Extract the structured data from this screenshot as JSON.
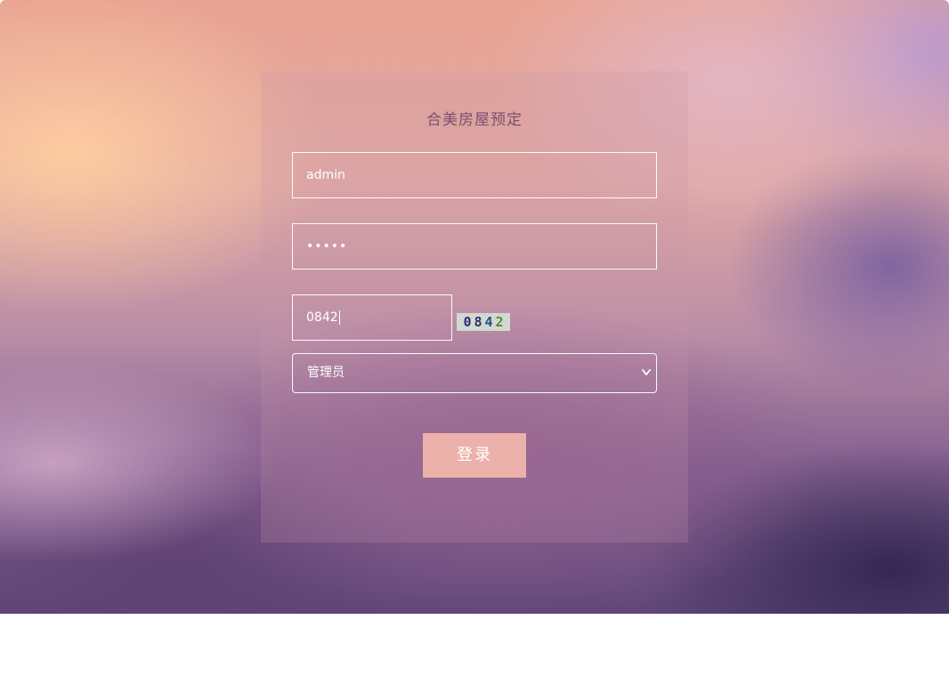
{
  "login": {
    "title": "合美房屋预定",
    "username_value": "admin",
    "password_value": "•••••",
    "captcha_value": "0842",
    "captcha_image_chars": [
      "0",
      "8",
      "4",
      "2"
    ],
    "role_selected": "管理员",
    "submit_label": "登录"
  },
  "colors": {
    "button": "#ebb1aa",
    "title": "#7a5070"
  }
}
